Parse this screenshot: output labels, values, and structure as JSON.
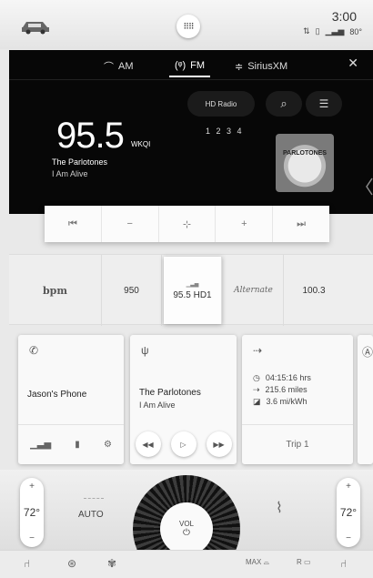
{
  "status_bar": {
    "time": "3:00",
    "temperature": "80°",
    "apps_icon": "apps-grid-icon"
  },
  "radio": {
    "bands": [
      {
        "label": "AM",
        "icon": "am-icon"
      },
      {
        "label": "FM",
        "icon": "fm-icon",
        "selected": true
      },
      {
        "label": "SiriusXM",
        "icon": "siriusxm-icon"
      }
    ],
    "hd_label": "HD Radio",
    "hd_channels": "1 2 3 4",
    "frequency": "95.5",
    "call_sign": "WKQI",
    "artist": "The Parlotones",
    "song": "I Am Alive",
    "album_art_text": "PARLOTONES"
  },
  "transport": {
    "buttons": [
      {
        "icon": "skip-back-icon",
        "glyph": "⏮"
      },
      {
        "icon": "tune-down-icon",
        "glyph": "−"
      },
      {
        "icon": "direct-tune-icon",
        "glyph": "⊹"
      },
      {
        "icon": "tune-up-icon",
        "glyph": "+"
      },
      {
        "icon": "skip-forward-icon",
        "glyph": "⏭"
      }
    ]
  },
  "presets": [
    {
      "label": "bpm",
      "kind": "logo"
    },
    {
      "label": "950"
    },
    {
      "label": "95.5 HD1",
      "active": true
    },
    {
      "label": "Alternate",
      "kind": "logo"
    },
    {
      "label": "100.3"
    }
  ],
  "phone_card": {
    "title": "Jason's Phone"
  },
  "media_card": {
    "artist": "The Parlotones",
    "song": "I Am Alive"
  },
  "trip_card": {
    "time": "04:15:16 hrs",
    "distance": "215.6 miles",
    "efficiency": "3.6 mi/kWh",
    "label": "Trip 1"
  },
  "climate": {
    "left_temp": "72°",
    "right_temp": "72°",
    "auto_label": "AUTO",
    "vol_label": "VOL",
    "max_defrost": "MAX",
    "rear_defrost": "R"
  }
}
